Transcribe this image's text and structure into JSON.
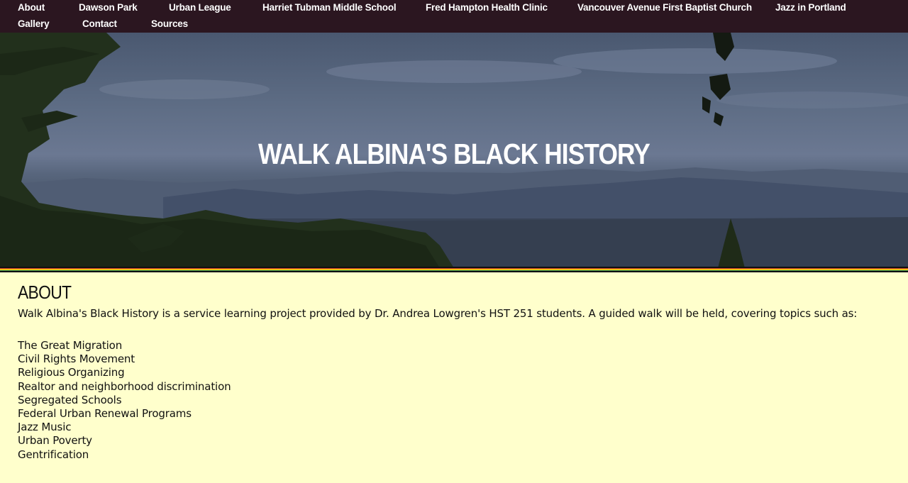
{
  "nav": {
    "items": [
      {
        "label": "About"
      },
      {
        "label": "Dawson Park"
      },
      {
        "label": "Urban League"
      },
      {
        "label": "Harriet Tubman Middle School"
      },
      {
        "label": "Fred Hampton Health Clinic"
      },
      {
        "label": "Vancouver Avenue First Baptist Church"
      },
      {
        "label": "Jazz in Portland"
      },
      {
        "label": "Gallery"
      },
      {
        "label": "Contact"
      },
      {
        "label": "Sources"
      }
    ]
  },
  "hero": {
    "title": "WALK ALBINA'S BLACK HISTORY"
  },
  "colors": {
    "nav_bg": "#2b1620",
    "page_bg": "#ffffcc",
    "stripes": [
      "#111111",
      "#c0392b",
      "#f1c40f",
      "#2e8b57",
      "#111111"
    ]
  },
  "about": {
    "title": "ABOUT",
    "intro": "Walk Albina's Black History is a service learning project provided by Dr. Andrea Lowgren's HST 251 students. A guided walk will be held, covering topics such as:",
    "topics": [
      "The Great Migration",
      "Civil Rights Movement",
      "Religious Organizing",
      "Realtor and neighborhood discrimination",
      "Segregated Schools",
      "Federal Urban Renewal Programs",
      "Jazz Music",
      "Urban Poverty",
      "Gentrification"
    ]
  }
}
